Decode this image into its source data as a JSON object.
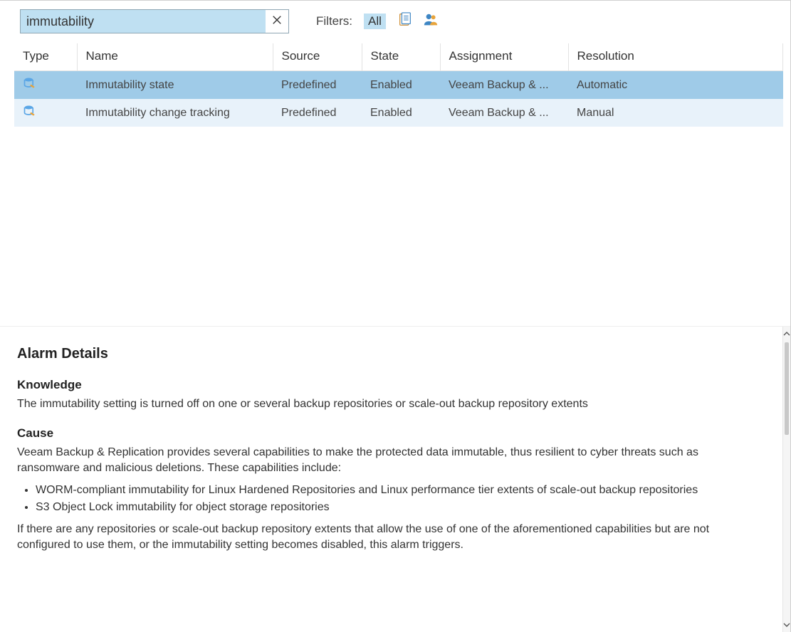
{
  "search": {
    "value": "immutability"
  },
  "filters": {
    "label": "Filters:",
    "all_chip": "All"
  },
  "columns": {
    "type": "Type",
    "name": "Name",
    "source": "Source",
    "state": "State",
    "assignment": "Assignment",
    "resolution": "Resolution"
  },
  "rows": [
    {
      "name": "Immutability state",
      "source": "Predefined",
      "state": "Enabled",
      "assignment": "Veeam Backup & ...",
      "resolution": "Automatic"
    },
    {
      "name": "Immutability change tracking",
      "source": "Predefined",
      "state": "Enabled",
      "assignment": "Veeam Backup & ...",
      "resolution": "Manual"
    }
  ],
  "details": {
    "heading": "Alarm Details",
    "knowledge_title": "Knowledge",
    "knowledge_text": "The immutability setting is turned off on one or several backup repositories or scale-out backup repository extents",
    "cause_title": "Cause",
    "cause_text": "Veeam Backup & Replication provides several capabilities to make the protected data immutable, thus resilient to cyber threats such as ransomware and malicious deletions. These capabilities include:",
    "cause_bullets": [
      "WORM-compliant immutability for Linux Hardened Repositories and Linux performance tier extents of scale-out backup repositories",
      "S3 Object Lock immutability for object storage repositories"
    ],
    "cause_after": "If there are any repositories or scale-out backup repository extents that allow the use of one of the aforementioned capabilities but are not configured to use them, or the immutability setting becomes disabled, this alarm triggers."
  }
}
